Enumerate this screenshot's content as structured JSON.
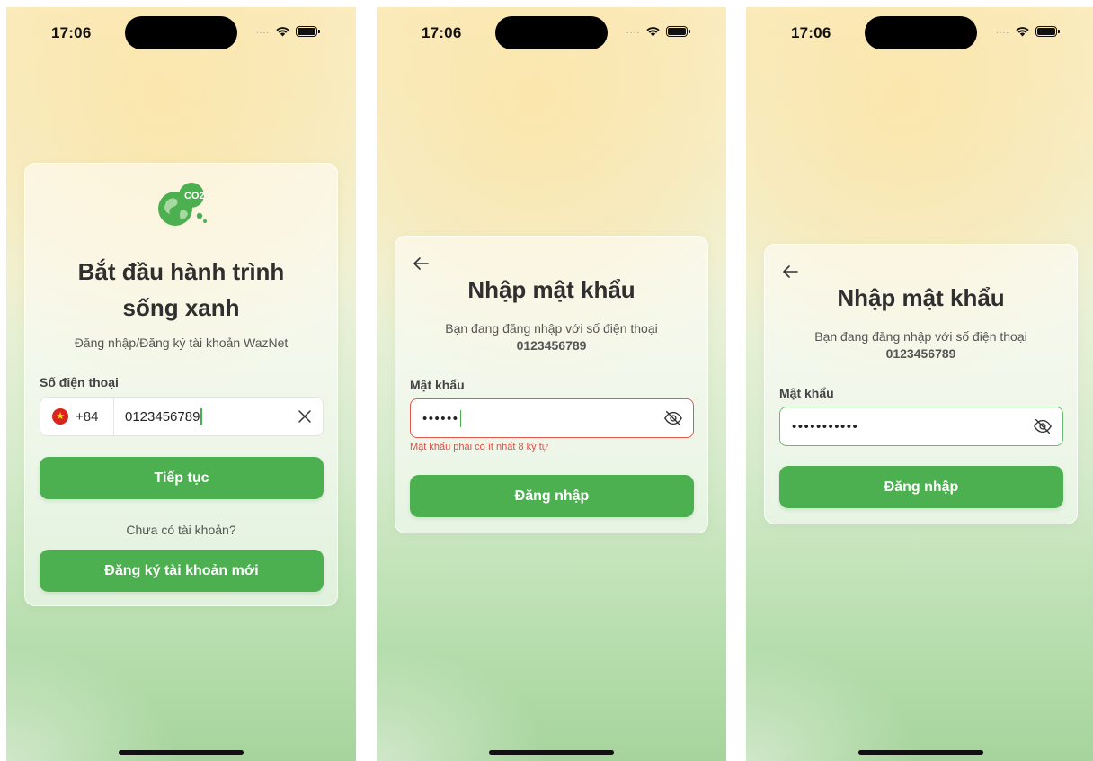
{
  "status_bar": {
    "time": "17:06",
    "signal_dots": "....",
    "wifi_icon": "wifi-icon",
    "battery_icon": "battery-icon"
  },
  "screen_phone": {
    "logo_icon": "co2-earth-icon",
    "logo_text": "CO2",
    "title_line1": "Bắt đầu hành trình",
    "title_line2": "sống xanh",
    "subtitle": "Đăng nhập/Đăng ký tài khoản WazNet",
    "phone_label": "Số điện thoại",
    "flag_icon": "vietnam-flag-icon",
    "country_code": "+84",
    "phone_value": "0123456789",
    "clear_icon": "close-icon",
    "continue_label": "Tiếp tục",
    "no_account_text": "Chưa có tài khoản?",
    "register_label": "Đăng ký tài khoản mới"
  },
  "screen_password_error": {
    "back_icon": "arrow-left-icon",
    "title": "Nhập mật khẩu",
    "subtitle": "Bạn đang đăng nhập với số điện thoại",
    "phone_number": "0123456789",
    "password_label": "Mật khẩu",
    "password_mask": "••••••",
    "eye_icon": "eye-off-icon",
    "error_text": "Mật khẩu phải có ít nhất 8 ký tự",
    "error_color": "#e04c43",
    "login_label": "Đăng nhập"
  },
  "screen_password_valid": {
    "back_icon": "arrow-left-icon",
    "title": "Nhập mật khẩu",
    "subtitle": "Bạn đang đăng nhập với số điện thoại",
    "phone_number": "0123456789",
    "password_label": "Mật khẩu",
    "password_mask": "•••••••••••",
    "eye_icon": "eye-off-icon",
    "valid_color": "#6bbd6e",
    "login_label": "Đăng nhập"
  },
  "colors": {
    "primary_button": "#4caf50",
    "caret": "#4aaf4f"
  }
}
